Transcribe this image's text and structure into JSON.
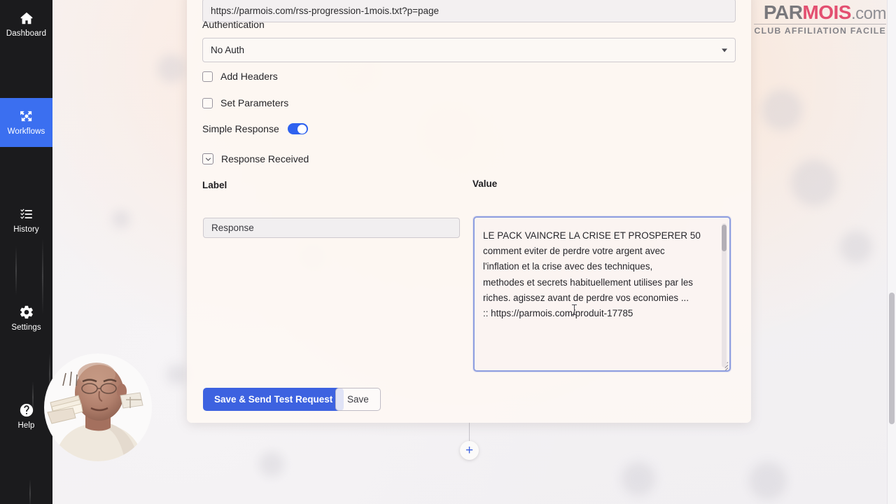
{
  "sidebar": {
    "items": [
      {
        "label": "Dashboard",
        "icon": "home-icon",
        "active": false
      },
      {
        "label": "Workflows",
        "icon": "workflows-icon",
        "active": true
      },
      {
        "label": "History",
        "icon": "history-list-icon",
        "active": false
      },
      {
        "label": "Settings",
        "icon": "gear-icon",
        "active": false
      },
      {
        "label": "Help",
        "icon": "help-circle-icon",
        "active": false
      }
    ]
  },
  "form": {
    "url_value": "https://parmois.com/rss-progression-1mois.txt?p=page",
    "authentication_label": "Authentication",
    "auth_selected": "No Auth",
    "add_headers_label": "Add Headers",
    "set_parameters_label": "Set Parameters",
    "simple_response_label": "Simple Response",
    "response_received_label": "Response Received",
    "label_column_header": "Label",
    "value_column_header": "Value",
    "label_value": "Response",
    "value_lines": [
      "LE PACK  VAINCRE LA CRISE ET PROSPERER  50",
      "comment eviter de perdre votre argent avec",
      "l'inflation et la crise avec des techniques,",
      "methodes et secrets habituellement utilises par les",
      "riches. agissez avant de perdre vos economies ...",
      ":: https://parmois.com/produit-17785"
    ]
  },
  "actions": {
    "primary_label": "Save & Send Test Request",
    "secondary_label": "Save",
    "add_node_label": "+"
  },
  "logo": {
    "part1": "PAR",
    "part2": "MOIS",
    "dot": ".",
    "tld": "com",
    "subtitle": "CLUB AFFILIATION FACILE"
  },
  "colors": {
    "accent_blue": "#3d62e0",
    "sidebar_active": "#3b6ff0",
    "sidebar_bg": "#1b1b1d",
    "logo_red": "#e24266",
    "logo_gray": "#6f6f74",
    "textarea_border": "#8f9fe0"
  }
}
